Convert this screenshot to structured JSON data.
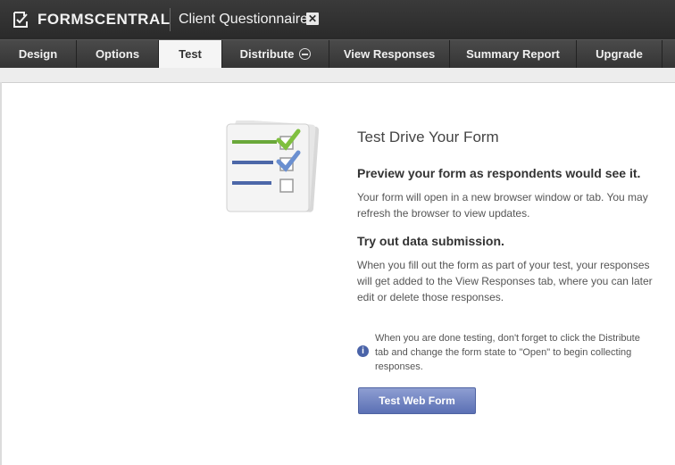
{
  "app": {
    "brand": "FORMSCENTRAL",
    "form_name": "Client Questionnaire",
    "close_symbol": "✕"
  },
  "tabs": [
    {
      "label": "Design"
    },
    {
      "label": "Options"
    },
    {
      "label": "Test",
      "active": true
    },
    {
      "label": "Distribute"
    },
    {
      "label": "View Responses"
    },
    {
      "label": "Summary Report"
    },
    {
      "label": "Upgrade"
    }
  ],
  "main": {
    "title": "Test Drive Your Form",
    "section1": {
      "heading": "Preview your form as respondents would see it.",
      "body": "Your form will open in a new browser window or tab. You may refresh the browser to view updates."
    },
    "section2": {
      "heading": "Try out data submission.",
      "body": "When you fill out the form as part of your test, your responses will get added to the View Responses tab, where you can later edit or delete those responses."
    },
    "note": "When you are done testing, don't forget to click the Distribute tab and change the form state to \"Open\" to begin collecting responses.",
    "info_icon_glyph": "i",
    "button_label": "Test Web Form"
  },
  "colors": {
    "button": "#6a7fc2",
    "check_green": "#7fbf3f",
    "check_blue": "#6a8fd0",
    "line_green": "#6aa83a",
    "line_blue": "#4c67a8"
  }
}
